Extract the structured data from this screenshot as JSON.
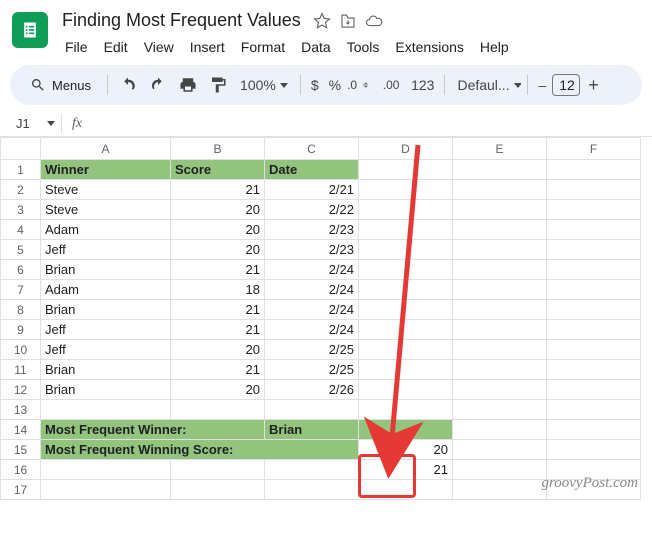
{
  "doc": {
    "title": "Finding Most Frequent Values"
  },
  "menu": {
    "file": "File",
    "edit": "Edit",
    "view": "View",
    "insert": "Insert",
    "format": "Format",
    "data": "Data",
    "tools": "Tools",
    "extensions": "Extensions",
    "help": "Help"
  },
  "toolbar": {
    "menus": "Menus",
    "zoom": "100%",
    "currency": "$",
    "percent": "%",
    "dec_dec": ".0",
    "dec_inc": ".00",
    "123": "123",
    "font": "Defaul...",
    "minus": "–",
    "fontsize": "12",
    "plus": "+"
  },
  "namebox": "J1",
  "fx_label": "fx",
  "columns": {
    "A": "A",
    "B": "B",
    "C": "C",
    "D": "D",
    "E": "E",
    "F": "F"
  },
  "rows": [
    "1",
    "2",
    "3",
    "4",
    "5",
    "6",
    "7",
    "8",
    "9",
    "10",
    "11",
    "12",
    "13",
    "14",
    "15",
    "16",
    "17"
  ],
  "headers": {
    "winner": "Winner",
    "score": "Score",
    "date": "Date"
  },
  "data_rows": [
    {
      "winner": "Steve",
      "score": "21",
      "date": "2/21"
    },
    {
      "winner": "Steve",
      "score": "20",
      "date": "2/22"
    },
    {
      "winner": "Adam",
      "score": "20",
      "date": "2/23"
    },
    {
      "winner": "Jeff",
      "score": "20",
      "date": "2/23"
    },
    {
      "winner": "Brian",
      "score": "21",
      "date": "2/24"
    },
    {
      "winner": "Adam",
      "score": "18",
      "date": "2/24"
    },
    {
      "winner": "Brian",
      "score": "21",
      "date": "2/24"
    },
    {
      "winner": "Jeff",
      "score": "21",
      "date": "2/24"
    },
    {
      "winner": "Jeff",
      "score": "20",
      "date": "2/25"
    },
    {
      "winner": "Brian",
      "score": "21",
      "date": "2/25"
    },
    {
      "winner": "Brian",
      "score": "20",
      "date": "2/26"
    }
  ],
  "summary": {
    "mfw_label": "Most Frequent Winner:",
    "mfw_value": "Brian",
    "mfws_label": "Most Frequent Winning Score:",
    "mfws_d15": "20",
    "mfws_d16": "21"
  },
  "watermark": "groovyPost.com"
}
